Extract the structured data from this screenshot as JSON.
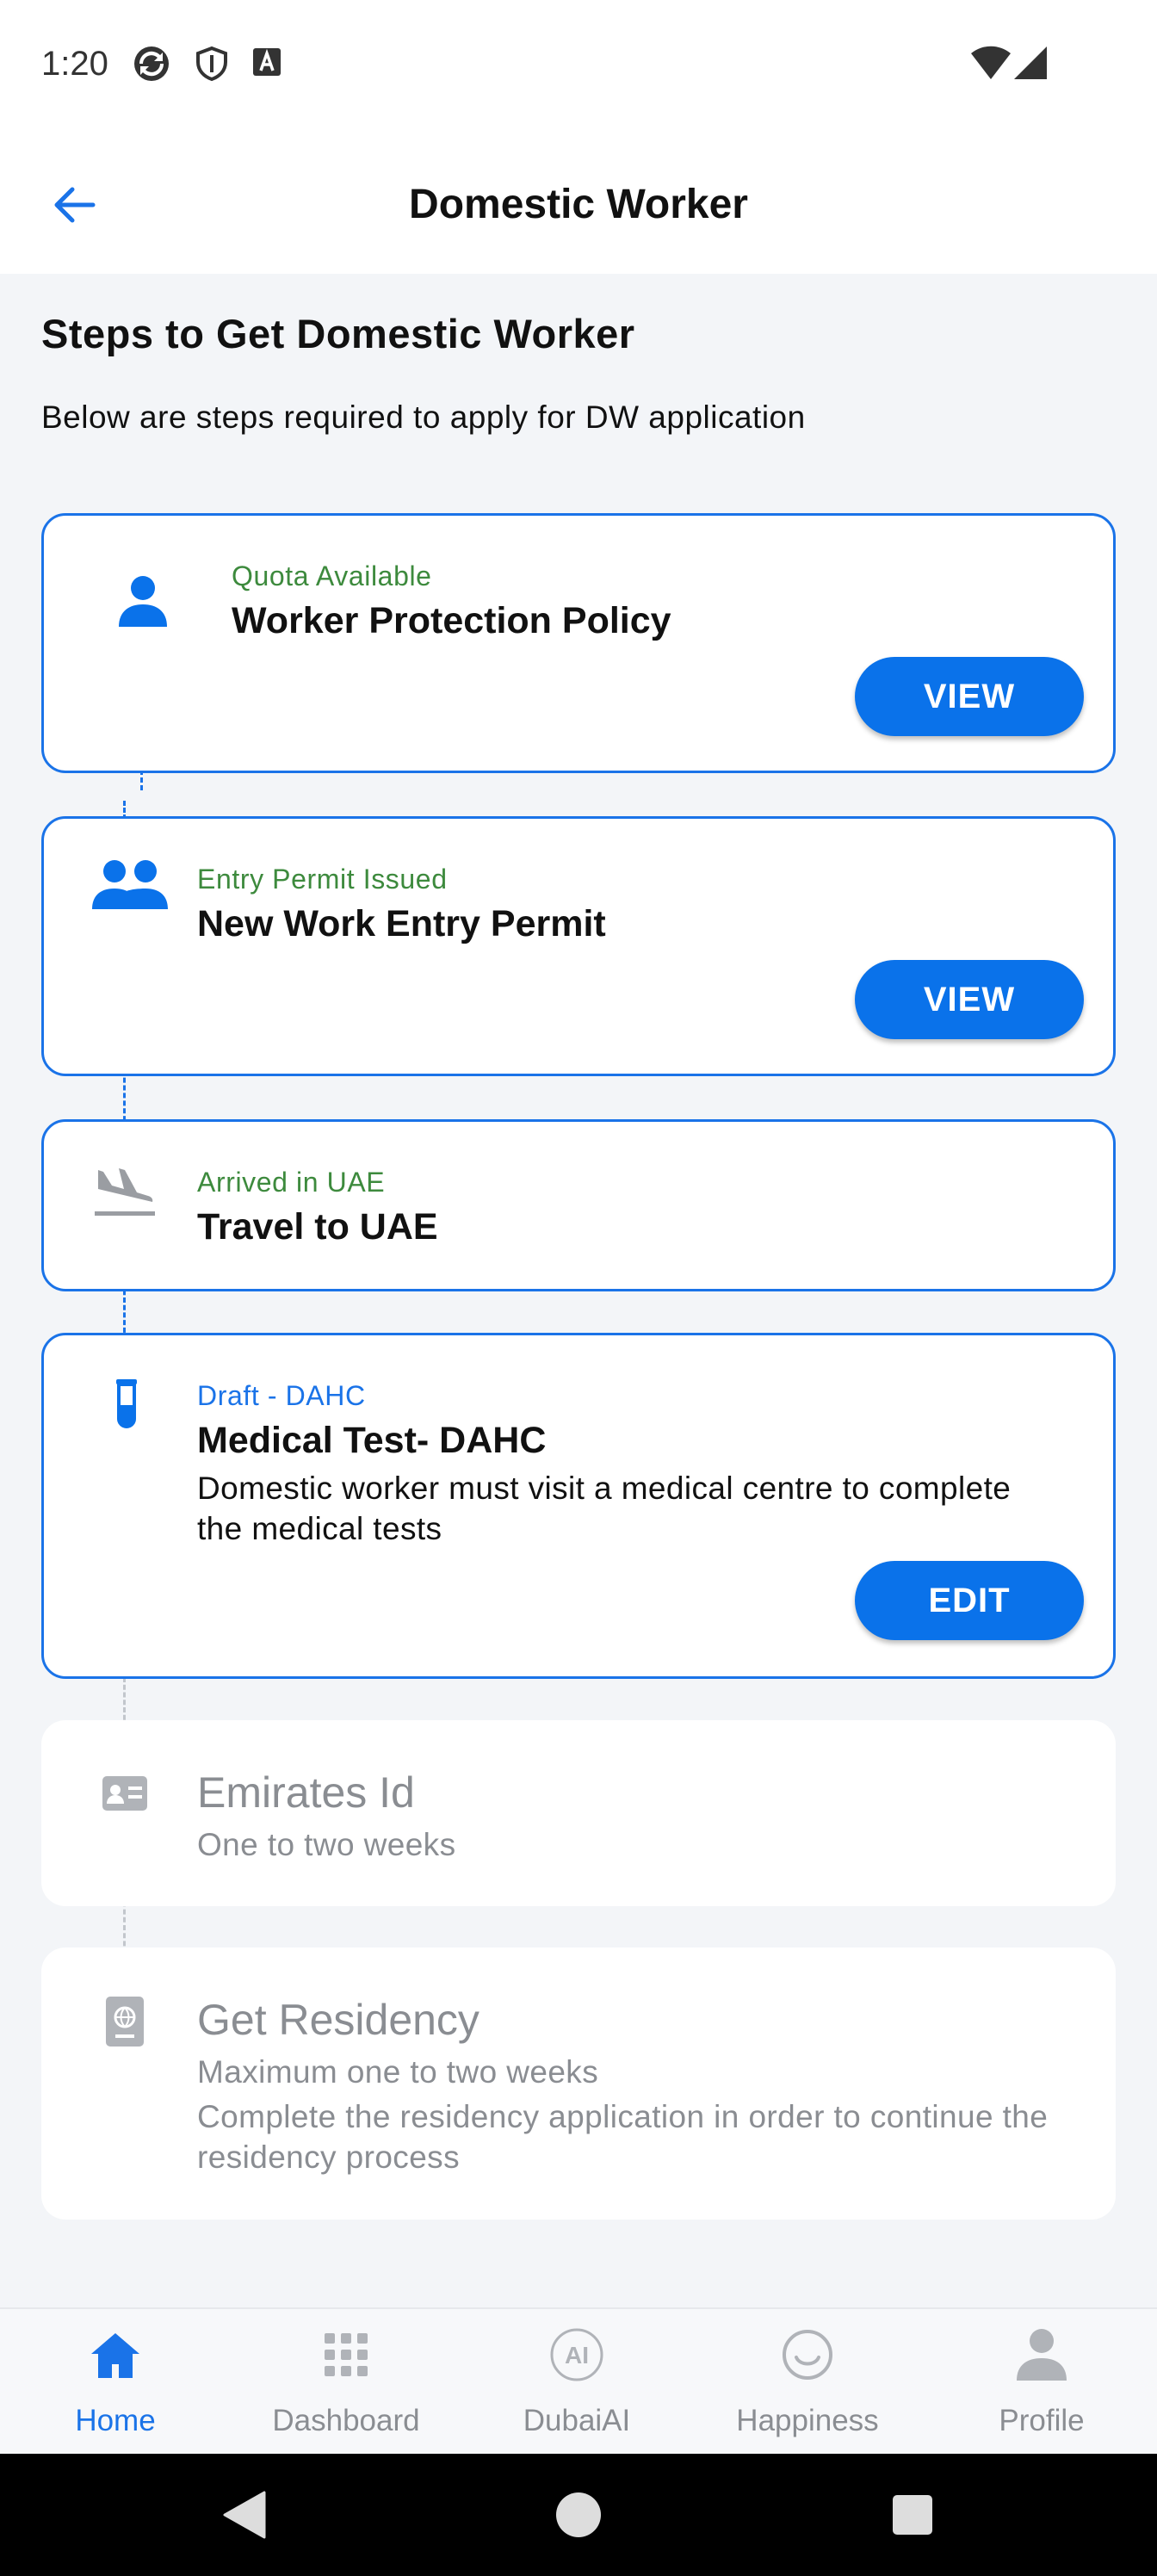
{
  "status_bar": {
    "time": "1:20"
  },
  "header": {
    "title": "Domestic Worker",
    "back_icon": "arrow-left-icon"
  },
  "intro": {
    "title": "Steps to Get Domestic Worker",
    "subtitle": "Below are steps required to apply for DW application"
  },
  "steps": [
    {
      "icon": "person-icon",
      "status": "Quota Available",
      "title": "Worker Protection Policy",
      "button": "VIEW"
    },
    {
      "icon": "people-icon",
      "status": "Entry Permit Issued",
      "title": "New Work Entry Permit",
      "button": "VIEW"
    },
    {
      "icon": "airplane-landing-icon",
      "status": "Arrived in UAE",
      "title": "Travel to UAE"
    },
    {
      "icon": "test-tube-icon",
      "status": "Draft - DAHC",
      "title": "Medical Test- DAHC",
      "description": "Domestic worker must visit a medical centre to complete the medical tests",
      "button": "EDIT"
    },
    {
      "icon": "id-card-icon",
      "title": "Emirates Id",
      "subtitle": "One to two weeks"
    },
    {
      "icon": "passport-icon",
      "title": "Get Residency",
      "subtitle": "Maximum one to two weeks",
      "description": "Complete the residency application in order to continue the residency process"
    }
  ],
  "bottom_nav": [
    {
      "label": "Home",
      "icon": "home-icon",
      "active": true
    },
    {
      "label": "Dashboard",
      "icon": "grid-icon",
      "active": false
    },
    {
      "label": "DubaiAI",
      "icon": "ai-icon",
      "active": false
    },
    {
      "label": "Happiness",
      "icon": "smiley-icon",
      "active": false
    },
    {
      "label": "Profile",
      "icon": "person-icon",
      "active": false
    }
  ],
  "colors": {
    "accent": "#1a73e8",
    "button": "#0a72ea",
    "status_green": "#3d8a3d",
    "disabled_text": "#8a8d92"
  }
}
